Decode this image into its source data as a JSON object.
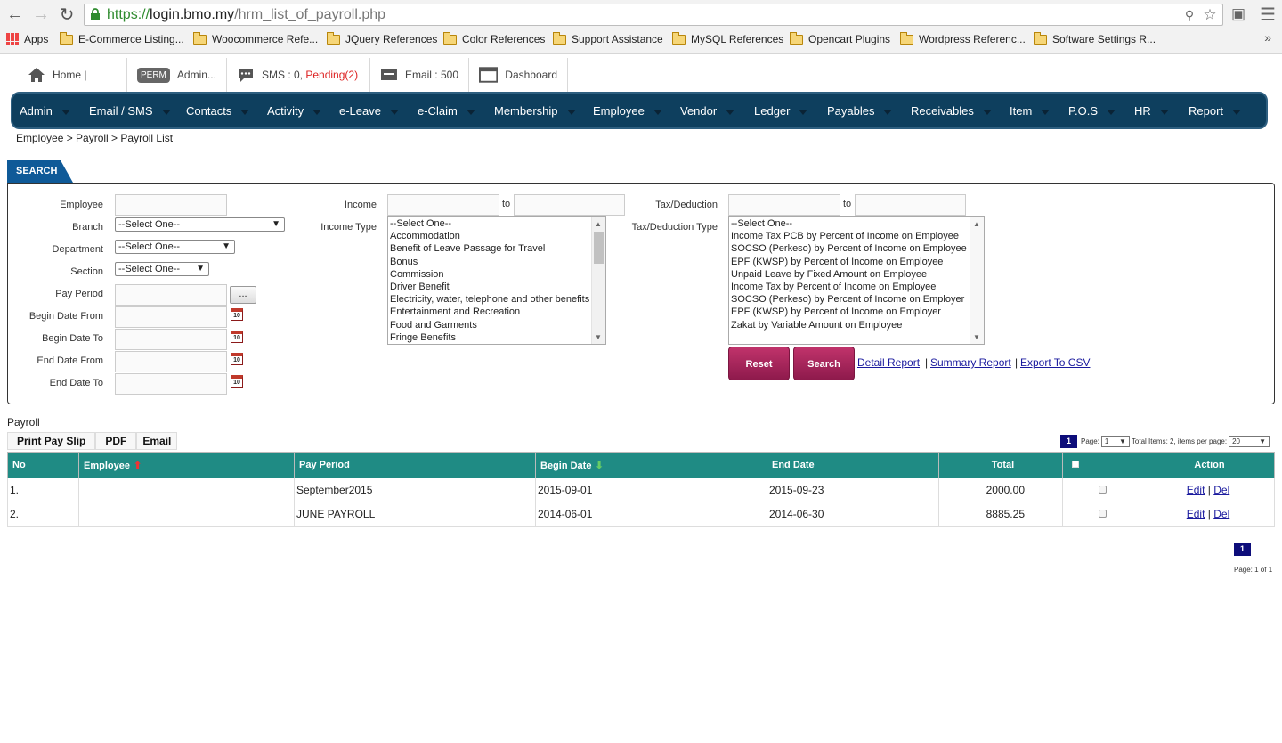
{
  "browser": {
    "url_scheme": "https://",
    "url_host": "login.bmo.my",
    "url_path": "/hrm_list_of_payroll.php",
    "bookmarks": {
      "apps": "Apps",
      "b1": "E-Commerce Listing...",
      "b2": "Woocommerce Refe...",
      "b3": "JQuery References",
      "b4": "Color References",
      "b5": "Support Assistance",
      "b6": "MySQL References",
      "b7": "Opencart Plugins",
      "b8": "Wordpress Referenc...",
      "b9": "Software Settings R..."
    },
    "more": "»"
  },
  "topstrip": {
    "home": "Home |",
    "perm_badge": "PERM",
    "admin": "Admin...",
    "sms_prefix": "SMS : 0, ",
    "sms_pending": "Pending(2)",
    "email": "Email : 500",
    "dashboard": "Dashboard"
  },
  "nav": {
    "admin": "Admin",
    "email_sms": "Email / SMS",
    "contacts": "Contacts",
    "activity": "Activity",
    "eleave": "e-Leave",
    "eclaim": "e-Claim",
    "membership": "Membership",
    "employee": "Employee",
    "vendor": "Vendor",
    "ledger": "Ledger",
    "payables": "Payables",
    "receivables": "Receivables",
    "item": "Item",
    "pos": "P.O.S",
    "hr": "HR",
    "report": "Report"
  },
  "breadcrumb": "Employee > Payroll > Payroll List",
  "search": {
    "tab": "SEARCH",
    "employee_label": "Employee",
    "branch_label": "Branch",
    "department_label": "Department",
    "section_label": "Section",
    "pay_period_label": "Pay Period",
    "begin_from_label": "Begin Date From",
    "begin_to_label": "Begin Date To",
    "end_from_label": "End Date From",
    "end_to_label": "End Date To",
    "select_one": "--Select One--",
    "dots": "...",
    "cal_day": "10",
    "income_label": "Income",
    "to": "to",
    "income_type_label": "Income Type",
    "income_types": [
      "--Select One--",
      "Accommodation",
      "Benefit of Leave Passage for Travel",
      "Bonus",
      "Commission",
      "Driver Benefit",
      "Electricity, water, telephone and other benefits",
      "Entertainment and Recreation",
      "Food and Garments",
      "Fringe Benefits"
    ],
    "tax_label": "Tax/Deduction",
    "tax_type_label": "Tax/Deduction Type",
    "tax_types": [
      "--Select One--",
      "Income Tax PCB by Percent of Income on Employee",
      "SOCSO (Perkeso) by Percent of Income on Employee",
      "EPF (KWSP) by Percent of Income on Employee",
      "Unpaid Leave by Fixed Amount on Employee",
      "Income Tax by Percent of Income on Employee",
      "SOCSO (Perkeso) by Percent of Income on Employer",
      "EPF (KWSP) by Percent of Income on Employer",
      "Zakat by Variable Amount on Employee"
    ],
    "reset": "Reset",
    "search": "Search",
    "detail_report": "Detail Report",
    "summary_report": "Summary Report",
    "export_csv": "Export To CSV",
    "pipe": "|"
  },
  "payroll": {
    "title": "Payroll",
    "print": "Print Pay Slip",
    "pdf": "PDF",
    "email": "Email",
    "pager": {
      "page_num": "1",
      "page_label": "Page:",
      "page_sel": "1",
      "total": "Total Items: 2, items per page:",
      "per_page": "20",
      "footer": "Page: 1 of 1"
    },
    "headers": {
      "no": "No",
      "employee": "Employee",
      "pay_period": "Pay Period",
      "begin_date": "Begin Date",
      "end_date": "End Date",
      "total": "Total",
      "action": "Action"
    },
    "rows": [
      {
        "no": "1.",
        "employee": "",
        "pay_period": "September2015",
        "begin": "2015-09-01",
        "end": "2015-09-23",
        "total": "2000.00",
        "edit": "Edit",
        "del": "Del"
      },
      {
        "no": "2.",
        "employee": "",
        "pay_period": "JUNE PAYROLL",
        "begin": "2014-06-01",
        "end": "2014-06-30",
        "total": "8885.25",
        "edit": "Edit",
        "del": "Del"
      }
    ]
  }
}
